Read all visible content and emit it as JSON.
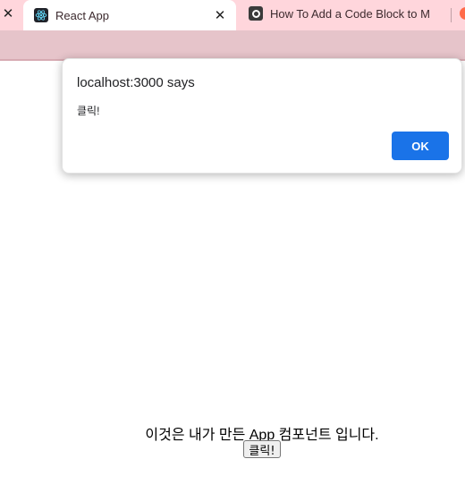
{
  "browser": {
    "tabs": [
      {
        "title": "React App",
        "favicon": "react-icon",
        "active": true
      },
      {
        "title": "How To Add a Code Block to M",
        "favicon": "site-icon",
        "active": false
      }
    ],
    "close_glyph": "✕"
  },
  "dialog": {
    "title": "localhost:3000 says",
    "message": "클릭!",
    "ok_label": "OK",
    "accent_color": "#1a73e8"
  },
  "app": {
    "text": "이것은 내가 만든 App 컴포넌트 입니다.",
    "button_label": "클릭!"
  }
}
